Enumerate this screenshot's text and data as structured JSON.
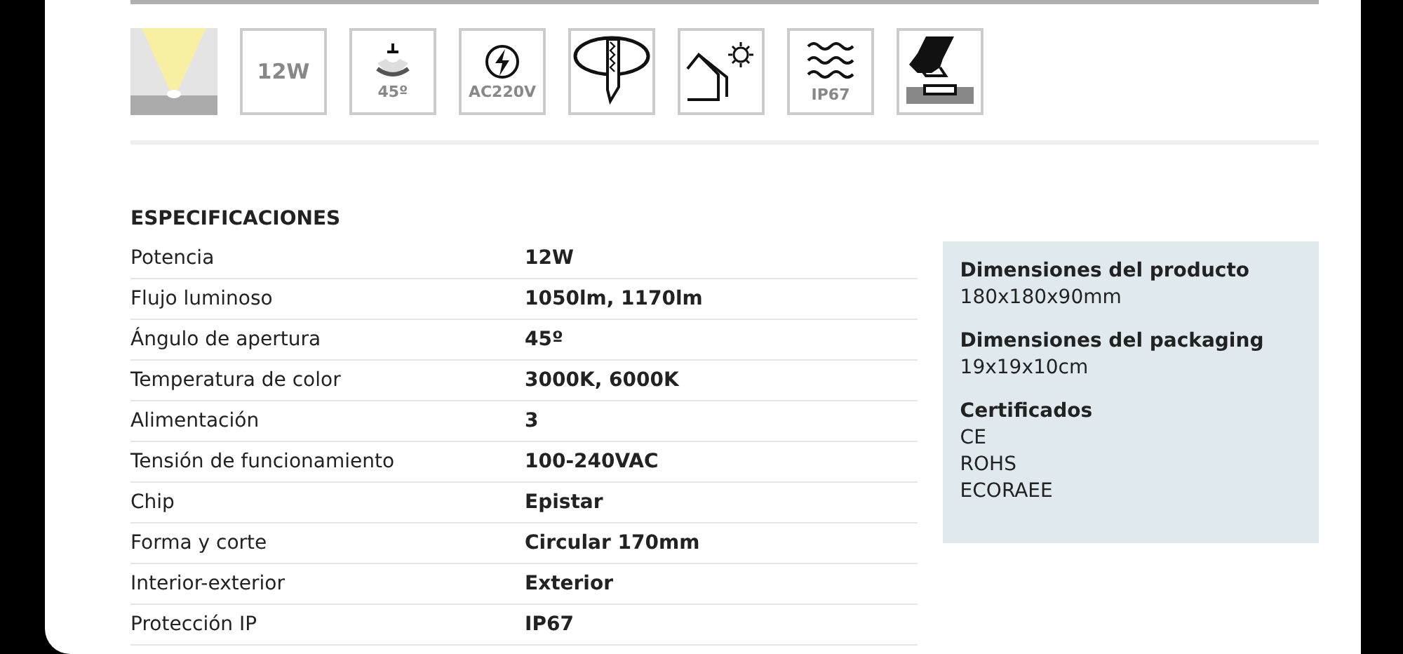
{
  "badges": [
    {
      "kind": "beam"
    },
    {
      "kind": "text",
      "label": "12W"
    },
    {
      "kind": "angle",
      "label": "45º"
    },
    {
      "kind": "power",
      "label": "AC220V"
    },
    {
      "kind": "cut"
    },
    {
      "kind": "outdoor"
    },
    {
      "kind": "water",
      "label": "IP67"
    },
    {
      "kind": "floor"
    }
  ],
  "specs": {
    "title": "ESPECIFICACIONES",
    "rows": [
      {
        "name": "Potencia",
        "value": "12W"
      },
      {
        "name": "Flujo luminoso",
        "value": "1050lm, 1170lm"
      },
      {
        "name": "Ángulo de apertura",
        "value": "45º"
      },
      {
        "name": "Temperatura de color",
        "value": "3000K, 6000K"
      },
      {
        "name": "Alimentación",
        "value": "3"
      },
      {
        "name": "Tensión de funcionamiento",
        "value": "100-240VAC"
      },
      {
        "name": "Chip",
        "value": "Epistar"
      },
      {
        "name": "Forma y corte",
        "value": "Circular 170mm"
      },
      {
        "name": "Interior-exterior",
        "value": "Exterior"
      },
      {
        "name": "Protección IP",
        "value": "IP67"
      }
    ]
  },
  "details": [
    {
      "heading": "Dimensiones del producto",
      "lines": [
        "180x180x90mm"
      ]
    },
    {
      "heading": "Dimensiones del packaging",
      "lines": [
        "19x19x10cm"
      ]
    },
    {
      "heading": "Certificados",
      "lines": [
        "CE",
        "ROHS",
        "ECORAEE"
      ]
    }
  ]
}
